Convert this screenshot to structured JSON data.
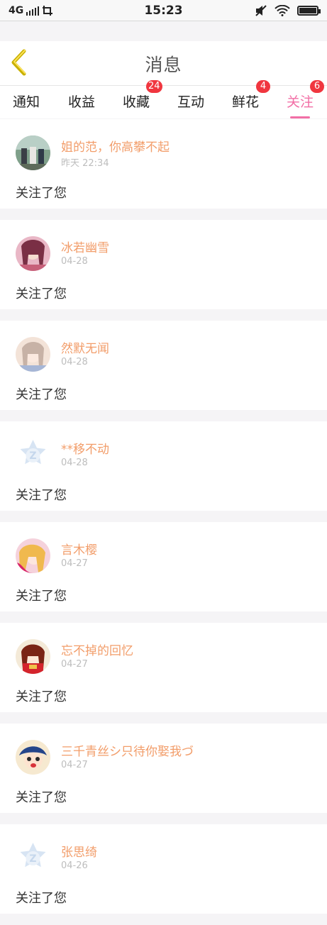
{
  "status_bar": {
    "network": "4G",
    "time": "15:23"
  },
  "header": {
    "title": "消息"
  },
  "tabs": [
    {
      "label": "通知",
      "badge": ""
    },
    {
      "label": "收益",
      "badge": ""
    },
    {
      "label": "收藏",
      "badge": "24"
    },
    {
      "label": "互动",
      "badge": ""
    },
    {
      "label": "鲜花",
      "badge": "4"
    },
    {
      "label": "关注",
      "badge": "6",
      "active": true
    }
  ],
  "colors": {
    "accent": "#f26fa6",
    "name": "#f29d6a",
    "badge": "#f0363f"
  },
  "items": [
    {
      "name": "姐的范，你高攀不起",
      "time": "昨天 22:34",
      "text": "关注了您",
      "avatar": "photo"
    },
    {
      "name": "冰若幽雪",
      "time": "04-28",
      "text": "关注了您",
      "avatar": "anime-pink"
    },
    {
      "name": "然默无闻",
      "time": "04-28",
      "text": "关注了您",
      "avatar": "anime-light"
    },
    {
      "name": "**移不动",
      "time": "04-28",
      "text": "关注了您",
      "avatar": "default"
    },
    {
      "name": "言木樱",
      "time": "04-27",
      "text": "关注了您",
      "avatar": "anime-blonde"
    },
    {
      "name": "忘不掉的回忆",
      "time": "04-27",
      "text": "关注了您",
      "avatar": "anime-red"
    },
    {
      "name": "三千青丝シ只待你娶我づ",
      "time": "04-27",
      "text": "关注了您",
      "avatar": "anime-blue"
    },
    {
      "name": "张思绮",
      "time": "04-26",
      "text": "关注了您",
      "avatar": "default"
    }
  ]
}
